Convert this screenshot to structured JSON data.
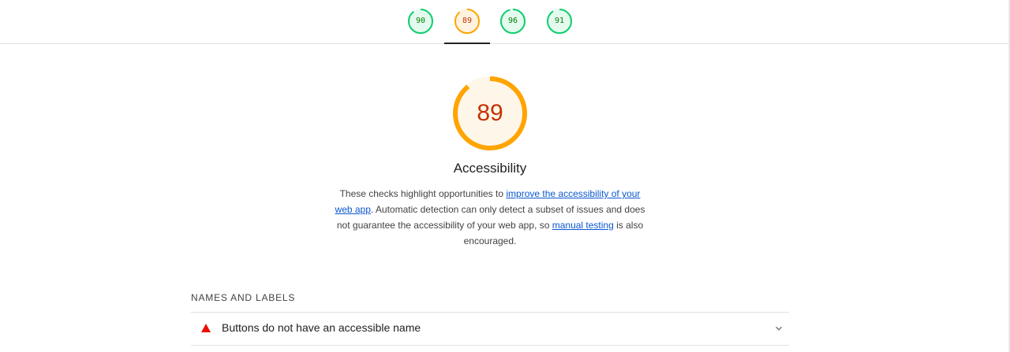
{
  "tabs": [
    {
      "score": "90",
      "rating": "pass",
      "color": "#0cce6b",
      "text_color": "#008000",
      "fill": "#e5faef"
    },
    {
      "score": "89",
      "rating": "average",
      "color": "#ffa400",
      "text_color": "#c33300",
      "fill": "#fff3e0"
    },
    {
      "score": "96",
      "rating": "pass",
      "color": "#0cce6b",
      "text_color": "#008000",
      "fill": "#e5faef"
    },
    {
      "score": "91",
      "rating": "pass",
      "color": "#0cce6b",
      "text_color": "#008000",
      "fill": "#e5faef"
    }
  ],
  "active_tab_index": 1,
  "category": {
    "score": "89",
    "score_value": 0.89,
    "gauge_color": "#ffa400",
    "gauge_fill": "#fff6ea",
    "title": "Accessibility",
    "desc_part1": "These checks highlight opportunities to ",
    "desc_link1": "improve the accessibility of your web app",
    "desc_part2": ". Automatic detection can only detect a subset of issues and does not guarantee the accessibility of your web app, so ",
    "desc_link2": "manual testing",
    "desc_part3": " is also encouraged."
  },
  "group": {
    "header": "NAMES AND LABELS"
  },
  "audits": [
    {
      "title": "Buttons do not have an accessible name",
      "status": "fail",
      "icon": "fail-triangle-icon",
      "icon_color": "#eb0f00"
    }
  ]
}
